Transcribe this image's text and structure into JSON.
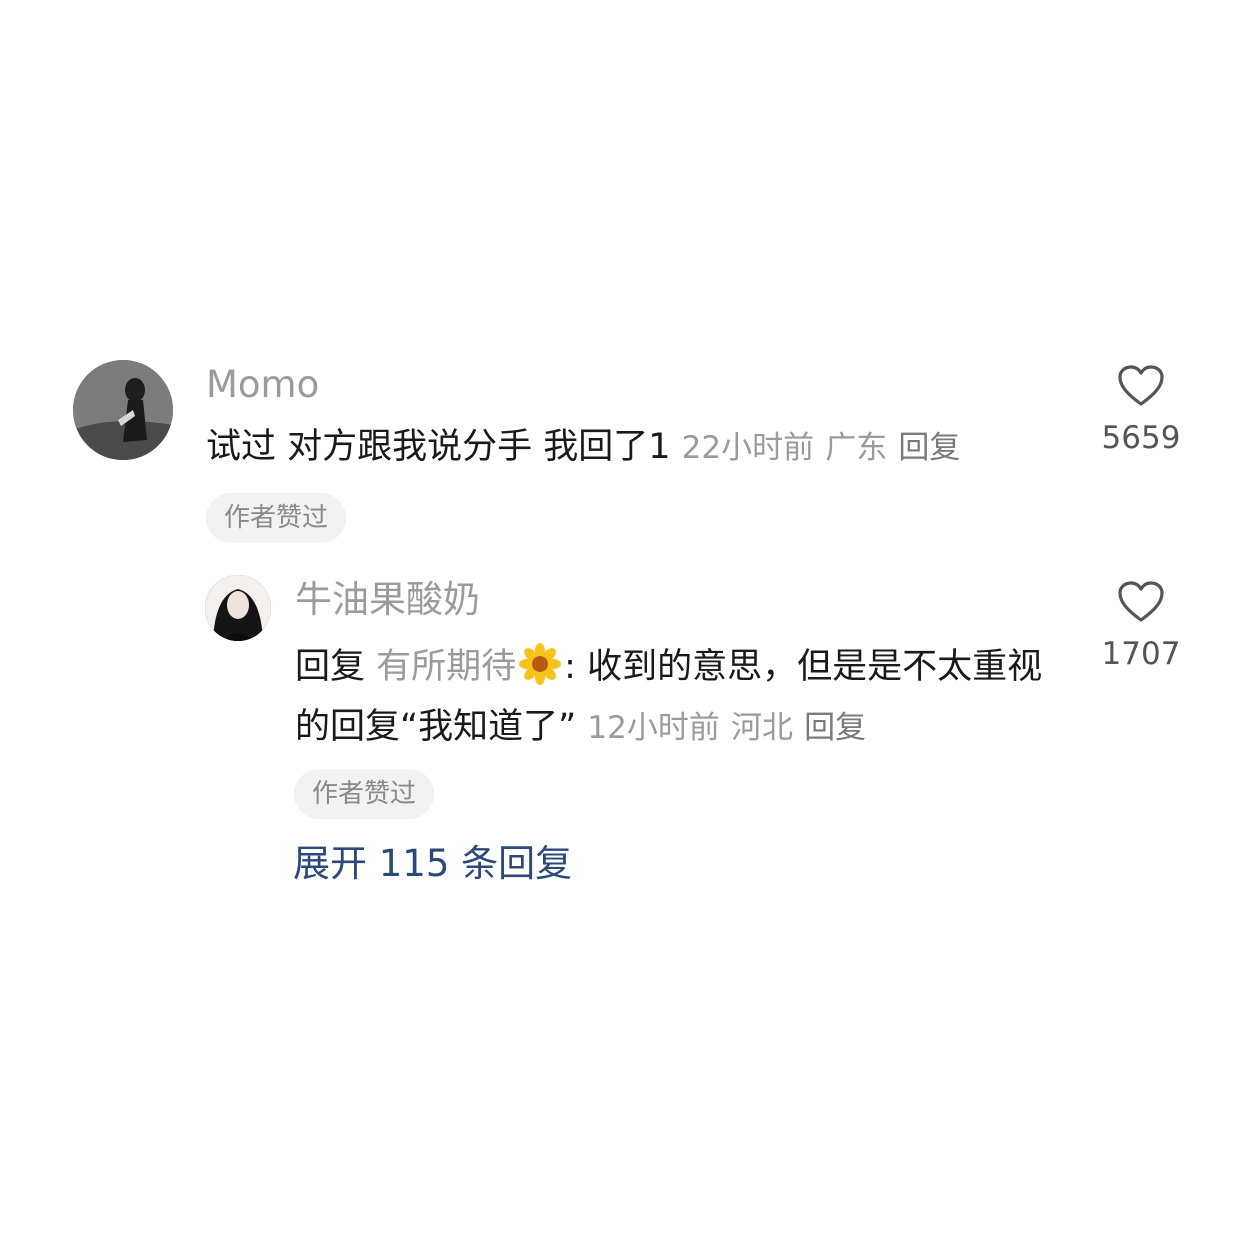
{
  "comments": [
    {
      "username": "Momo",
      "text": "试过 对方跟我说分手 我回了1",
      "time": "22小时前",
      "location": "广东",
      "reply_label": "回复",
      "badge": "作者赞过",
      "likes": "5659",
      "avatar_icon": "avatar-image"
    },
    {
      "username": "牛油果酸奶",
      "reply_prefix": "回复",
      "reply_to": "有所期待",
      "reply_to_emoji": "sunflower-icon",
      "text_part1": ": 收到的意思，但是是不太重视的回复“我知道了”",
      "time": "12小时前",
      "location": "河北",
      "reply_label": "回复",
      "badge": "作者赞过",
      "likes": "1707",
      "avatar_icon": "avatar-image"
    }
  ],
  "expand_label": "展开 115 条回复",
  "colors": {
    "muted_text": "#9b9b9b",
    "link_blue": "#2b4a7a",
    "badge_bg": "#f2f2f2"
  }
}
